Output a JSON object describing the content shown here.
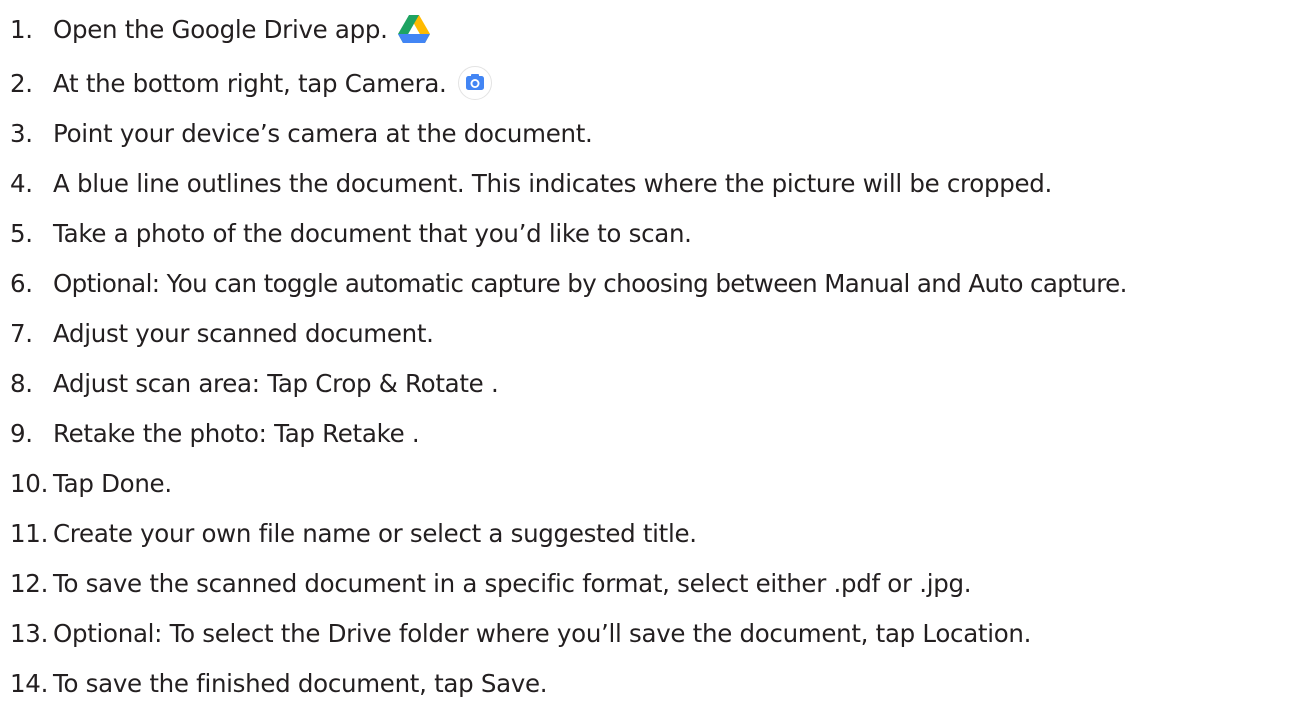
{
  "steps": [
    {
      "num": "1.",
      "text": "Open the Google Drive app.",
      "icon": "google-drive-icon"
    },
    {
      "num": "2.",
      "text": "At the bottom right, tap Camera.",
      "icon": "camera-icon"
    },
    {
      "num": "3.",
      "text": "Point your device’s camera at the document."
    },
    {
      "num": "4.",
      "text": "A blue line outlines the document. This indicates where the picture will be cropped."
    },
    {
      "num": "5.",
      "text": "Take a photo of the document that you’d like to scan."
    },
    {
      "num": "6.",
      "text": "Optional: You can toggle automatic capture by choosing between Manual and Auto capture."
    },
    {
      "num": "7.",
      "text": "Adjust your scanned document."
    },
    {
      "num": "8.",
      "text": "Adjust scan area: Tap Crop & Rotate ."
    },
    {
      "num": "9.",
      "text": "Retake the photo: Tap Retake ."
    },
    {
      "num": "10.",
      "text": "Tap Done."
    },
    {
      "num": "11.",
      "text": "Create your own file name or select a suggested title."
    },
    {
      "num": "12.",
      "text": "To save the scanned document in a specific format, select either .pdf or .jpg."
    },
    {
      "num": "13.",
      "text": "Optional: To select the Drive folder where you’ll save the document, tap Location."
    },
    {
      "num": "14.",
      "text": "To save the finished document, tap Save."
    }
  ],
  "colors": {
    "text": "#231f20",
    "drive_green": "#1ea362",
    "drive_yellow": "#ffba00",
    "drive_blue": "#4285f4",
    "camera_blue": "#4285f4"
  }
}
